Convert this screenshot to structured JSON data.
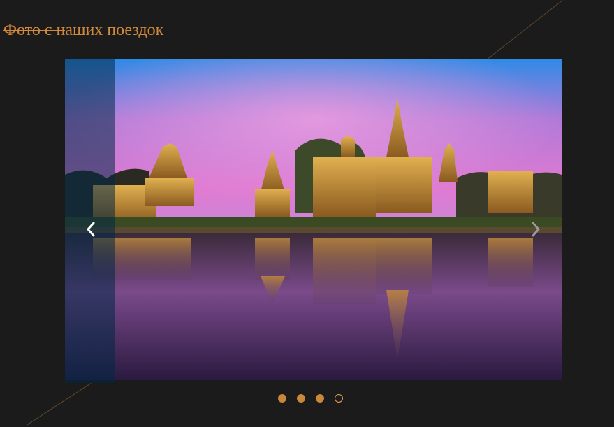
{
  "section": {
    "title": "Фото с наших поездок"
  },
  "slider": {
    "current_slide_index": 4,
    "total_slides": 4,
    "prev_icon": "chevron-left-icon",
    "next_icon": "chevron-right-icon",
    "image_subject": "temple-ruins-at-dusk-reflection",
    "dots": [
      {
        "active": false
      },
      {
        "active": false
      },
      {
        "active": false
      },
      {
        "active": true
      }
    ]
  },
  "colors": {
    "background": "#1b1b1b",
    "accent": "#d2893a",
    "dot": "#c9873a",
    "active_dot_border": "#e9a250"
  }
}
